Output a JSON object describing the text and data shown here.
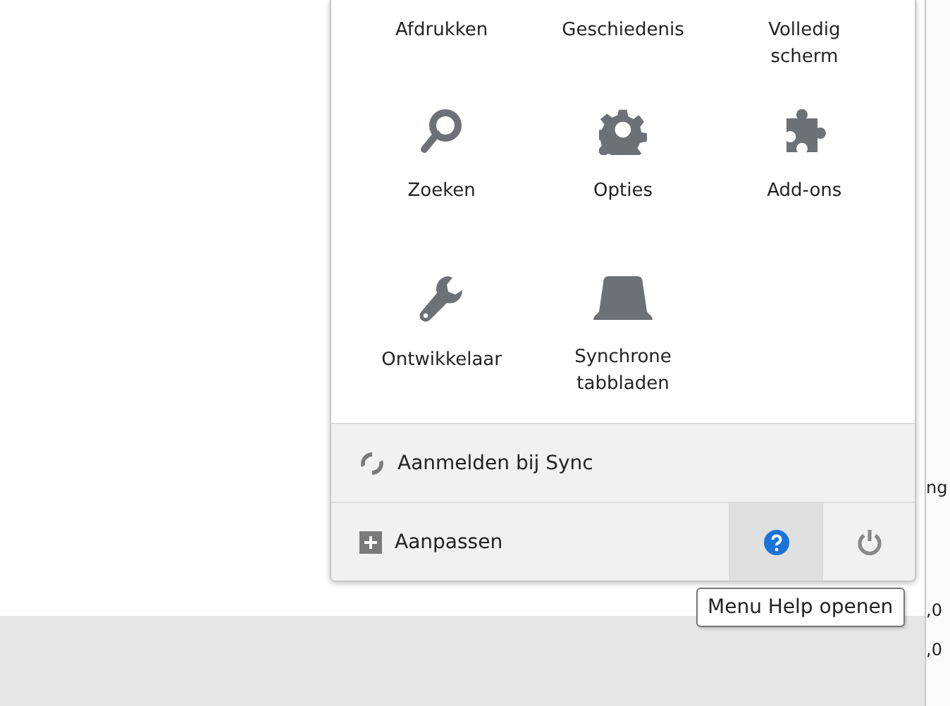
{
  "menu": {
    "items": [
      {
        "label": "Afdrukken",
        "kind": "label-only"
      },
      {
        "label": "Geschiedenis",
        "kind": "label-only"
      },
      {
        "label": "Volledig\nscherm",
        "kind": "label-only"
      },
      {
        "label": "Zoeken",
        "kind": "search"
      },
      {
        "label": "Opties",
        "kind": "settings"
      },
      {
        "label": "Add-ons",
        "kind": "addons"
      },
      {
        "label": "Ontwikkelaar",
        "kind": "developer"
      },
      {
        "label": "Synchrone\ntabbladen",
        "kind": "synced-tabs"
      }
    ],
    "sync": {
      "label": "Aanmelden bij Sync"
    },
    "footer": {
      "customize": {
        "label": "Aanpassen"
      },
      "buttons": [
        {
          "kind": "help",
          "hovered": true
        },
        {
          "kind": "power",
          "hovered": false
        }
      ]
    }
  },
  "tooltip": "Menu Help openen",
  "side_strip": {
    "texts": [
      "ng",
      ",0",
      ",0"
    ]
  }
}
